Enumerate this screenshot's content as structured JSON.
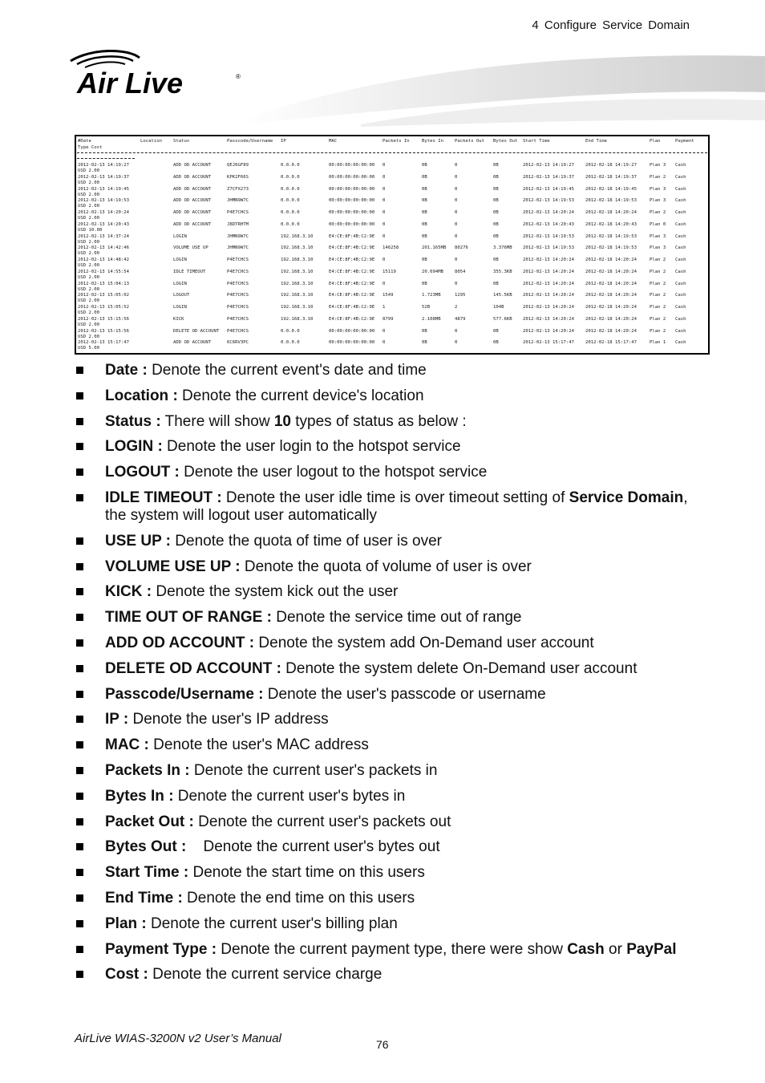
{
  "header": {
    "chapter": "4  Configure  Service  Domain",
    "logo_text": "Air Live"
  },
  "log_table": {
    "headers": [
      "#Date",
      "Location",
      "Status",
      "Passcode/Username",
      "IP",
      "MAC",
      "Packets In",
      "Bytes In",
      "Packets Out",
      "Bytes Out",
      "Start Time",
      "End Time",
      "Plan",
      "Payment"
    ],
    "header_line2": "Type Cost",
    "rows": [
      {
        "date": "2012-02-13 14:19:27",
        "location": "",
        "status": "ADD OD ACCOUNT",
        "user": "QEJ6GF89",
        "ip": "0.0.0.0",
        "mac": "00:00:00:00:00:00",
        "pin": "0",
        "bin": "0B",
        "pout": "0",
        "bout": "0B",
        "start": "2012-02-13 14:19:27",
        "end": "2012-02-18 14:19:27",
        "plan": "Plan 3",
        "payment": "Cash",
        "cost": "USD 2.00"
      },
      {
        "date": "2012-02-13 14:19:37",
        "location": "",
        "status": "ADD OD ACCOUNT",
        "user": "KPK2F66S",
        "ip": "0.0.0.0",
        "mac": "00:00:00:00:00:00",
        "pin": "0",
        "bin": "0B",
        "pout": "0",
        "bout": "0B",
        "start": "2012-02-13 14:19:37",
        "end": "2012-02-18 14:19:37",
        "plan": "Plan 2",
        "payment": "Cash",
        "cost": "USD 2.00"
      },
      {
        "date": "2012-02-13 14:19:45",
        "location": "",
        "status": "ADD OD ACCOUNT",
        "user": "Z7CFX273",
        "ip": "0.0.0.0",
        "mac": "00:00:00:00:00:00",
        "pin": "0",
        "bin": "0B",
        "pout": "0",
        "bout": "0B",
        "start": "2012-02-13 14:19:45",
        "end": "2012-02-18 14:19:45",
        "plan": "Plan 3",
        "payment": "Cash",
        "cost": "USD 2.00"
      },
      {
        "date": "2012-02-13 14:19:53",
        "location": "",
        "status": "ADD OD ACCOUNT",
        "user": "JHMN9W7C",
        "ip": "0.0.0.0",
        "mac": "00:00:00:00:00:00",
        "pin": "0",
        "bin": "0B",
        "pout": "0",
        "bout": "0B",
        "start": "2012-02-13 14:19:53",
        "end": "2012-02-18 14:19:53",
        "plan": "Plan 3",
        "payment": "Cash",
        "cost": "USD 2.00"
      },
      {
        "date": "2012-02-13 14:20:24",
        "location": "",
        "status": "ADD OD ACCOUNT",
        "user": "P4E7CHCS",
        "ip": "0.0.0.0",
        "mac": "00:00:00:00:00:00",
        "pin": "0",
        "bin": "0B",
        "pout": "0",
        "bout": "0B",
        "start": "2012-02-13 14:20:24",
        "end": "2012-02-18 14:20:24",
        "plan": "Plan 2",
        "payment": "Cash",
        "cost": "USD 2.00"
      },
      {
        "date": "2012-02-13 14:20:43",
        "location": "",
        "status": "ADD OD ACCOUNT",
        "user": "J8DTRHTM",
        "ip": "0.0.0.0",
        "mac": "00:00:00:00:00:00",
        "pin": "0",
        "bin": "0B",
        "pout": "0",
        "bout": "0B",
        "start": "2012-02-13 14:20:43",
        "end": "2012-02-18 14:20:43",
        "plan": "Plan 0",
        "payment": "Cash",
        "cost": "USD 10.00"
      },
      {
        "date": "2012-02-13 14:37:24",
        "location": "",
        "status": "LOGIN",
        "user": "JHMN9W7C",
        "ip": "192.168.3.10",
        "mac": "E4:CE:8F:4B:C2:9E",
        "pin": "0",
        "bin": "0B",
        "pout": "0",
        "bout": "0B",
        "start": "2012-02-13 14:19:53",
        "end": "2012-02-18 14:19:53",
        "plan": "Plan 3",
        "payment": "Cash",
        "cost": "USD 2.00"
      },
      {
        "date": "2012-02-13 14:42:46",
        "location": "",
        "status": "VOLUME USE UP",
        "user": "JHMN9W7C",
        "ip": "192.168.3.10",
        "mac": "E4:CE:8F:4B:C2:9E",
        "pin": "146258",
        "bin": "201.165MB",
        "pout": "80276",
        "bout": "3.376MB",
        "start": "2012-02-13 14:19:53",
        "end": "2012-02-18 14:19:53",
        "plan": "Plan 3",
        "payment": "Cash",
        "cost": "USD 2.00"
      },
      {
        "date": "2012-02-13 14:48:42",
        "location": "",
        "status": "LOGIN",
        "user": "P4E7CHCS",
        "ip": "192.168.3.10",
        "mac": "E4:CE:8F:4B:C2:9E",
        "pin": "0",
        "bin": "0B",
        "pout": "0",
        "bout": "0B",
        "start": "2012-02-13 14:20:24",
        "end": "2012-02-18 14:20:24",
        "plan": "Plan 2",
        "payment": "Cash",
        "cost": "USD 2.00"
      },
      {
        "date": "2012-02-13 14:55:54",
        "location": "",
        "status": "IDLE TIMEOUT",
        "user": "P4E7CHCS",
        "ip": "192.168.3.10",
        "mac": "E4:CE:8F:4B:C2:9E",
        "pin": "15119",
        "bin": "20.694MB",
        "pout": "8054",
        "bout": "355.3KB",
        "start": "2012-02-13 14:20:24",
        "end": "2012-02-18 14:20:24",
        "plan": "Plan 2",
        "payment": "Cash",
        "cost": "USD 2.00"
      },
      {
        "date": "2012-02-13 15:04:13",
        "location": "",
        "status": "LOGIN",
        "user": "P4E7CHCS",
        "ip": "192.168.3.10",
        "mac": "E4:CE:8F:4B:C2:9E",
        "pin": "0",
        "bin": "0B",
        "pout": "0",
        "bout": "0B",
        "start": "2012-02-13 14:20:24",
        "end": "2012-02-18 14:20:24",
        "plan": "Plan 2",
        "payment": "Cash",
        "cost": "USD 2.00"
      },
      {
        "date": "2012-02-13 15:05:02",
        "location": "",
        "status": "LOGOUT",
        "user": "P4E7CHCS",
        "ip": "192.168.3.10",
        "mac": "E4:CE:8F:4B:C2:9E",
        "pin": "1549",
        "bin": "1.723MB",
        "pout": "1295",
        "bout": "145.5KB",
        "start": "2012-02-13 14:20:24",
        "end": "2012-02-18 14:20:24",
        "plan": "Plan 2",
        "payment": "Cash",
        "cost": "USD 2.00"
      },
      {
        "date": "2012-02-13 15:05:52",
        "location": "",
        "status": "LOGIN",
        "user": "P4E7CHCS",
        "ip": "192.168.3.10",
        "mac": "E4:CE:8F:4B:C2:9E",
        "pin": "1",
        "bin": "52B",
        "pout": "2",
        "bout": "104B",
        "start": "2012-02-13 14:20:24",
        "end": "2012-02-18 14:20:24",
        "plan": "Plan 2",
        "payment": "Cash",
        "cost": "USD 2.00"
      },
      {
        "date": "2012-02-13 15:15:56",
        "location": "",
        "status": "KICK",
        "user": "P4E7CHCS",
        "ip": "192.168.3.10",
        "mac": "E4:CE:8F:4B:C2:9E",
        "pin": "8799",
        "bin": "2.108MB",
        "pout": "4879",
        "bout": "577.6KB",
        "start": "2012-02-13 14:20:24",
        "end": "2012-02-18 14:20:24",
        "plan": "Plan 2",
        "payment": "Cash",
        "cost": "USD 2.00"
      },
      {
        "date": "2012-02-13 15:15:56",
        "location": "",
        "status": "DELETE OD ACCOUNT",
        "user": "P4E7CHCS",
        "ip": "0.0.0.0",
        "mac": "00:00:00:00:00:00",
        "pin": "0",
        "bin": "0B",
        "pout": "0",
        "bout": "0B",
        "start": "2012-02-13 14:20:24",
        "end": "2012-02-18 14:20:24",
        "plan": "Plan 2",
        "payment": "Cash",
        "cost": "USD 2.00"
      },
      {
        "date": "2012-02-13 15:17:47",
        "location": "",
        "status": "ADD OD ACCOUNT",
        "user": "6C6RV3PC",
        "ip": "0.0.0.0",
        "mac": "00:00:00:00:00:00",
        "pin": "0",
        "bin": "0B",
        "pout": "0",
        "bout": "0B",
        "start": "2012-02-13 15:17:47",
        "end": "2012-02-18 15:17:47",
        "plan": "Plan 1",
        "payment": "Cash",
        "cost": "USD 5.00"
      }
    ]
  },
  "bullets": [
    [
      {
        "b": "Date :"
      },
      {
        "t": " Denote the current event's date and time"
      }
    ],
    [
      {
        "b": "Location :"
      },
      {
        "t": " Denote the current device's location"
      }
    ],
    [
      {
        "b": "Status :"
      },
      {
        "t": " There will show "
      },
      {
        "b": "10"
      },
      {
        "t": " types of status as below :"
      }
    ],
    [
      {
        "b": "LOGIN :"
      },
      {
        "t": " Denote the user login to the hotspot service"
      }
    ],
    [
      {
        "b": "LOGOUT :"
      },
      {
        "t": " Denote the user logout to the hotspot service"
      }
    ],
    [
      {
        "b": "IDLE TIMEOUT :"
      },
      {
        "t": " Denote the user idle time is over timeout setting of "
      },
      {
        "b": "Service Domain"
      },
      {
        "t": ", the system will logout user automatically"
      }
    ],
    [
      {
        "b": "USE UP :"
      },
      {
        "t": " Denote the quota of time of user is over"
      }
    ],
    [
      {
        "b": "VOLUME USE UP :"
      },
      {
        "t": " Denote the quota of volume of user is over"
      }
    ],
    [
      {
        "b": "KICK :"
      },
      {
        "t": " Denote the system kick out the user"
      }
    ],
    [
      {
        "b": "TIME OUT OF RANGE :"
      },
      {
        "t": " Denote the service time out of range"
      }
    ],
    [
      {
        "b": "ADD OD ACCOUNT :"
      },
      {
        "t": " Denote the system add On-Demand user account"
      }
    ],
    [
      {
        "b": "DELETE OD ACCOUNT :"
      },
      {
        "t": " Denote the system delete On-Demand user account"
      }
    ],
    [
      {
        "b": "Passcode/Username :"
      },
      {
        "t": " Denote the user's passcode or username"
      }
    ],
    [
      {
        "b": "IP :"
      },
      {
        "t": " Denote the user's IP address"
      }
    ],
    [
      {
        "b": "MAC :"
      },
      {
        "t": " Denote the user's MAC address"
      }
    ],
    [
      {
        "b": "Packets In :"
      },
      {
        "t": " Denote the current user's packets in"
      }
    ],
    [
      {
        "b": "Bytes In :"
      },
      {
        "t": " Denote the current user's bytes in"
      }
    ],
    [
      {
        "b": "Packet Out :"
      },
      {
        "t": " Denote the current user's packets out"
      }
    ],
    [
      {
        "b": "Bytes Out :"
      },
      {
        "t": "    Denote the current user's bytes out"
      }
    ],
    [
      {
        "b": "Start Time :"
      },
      {
        "t": " Denote the start time on this users"
      }
    ],
    [
      {
        "b": "End Time :"
      },
      {
        "t": " Denote the end time on this users"
      }
    ],
    [
      {
        "b": "Plan :"
      },
      {
        "t": " Denote the current user's billing plan"
      }
    ],
    [
      {
        "b": "Payment Type :"
      },
      {
        "t": " Denote the current payment type, there were show "
      },
      {
        "b": "Cash"
      },
      {
        "t": " or "
      },
      {
        "b": "PayPal"
      }
    ],
    [
      {
        "b": "Cost :"
      },
      {
        "t": " Denote the current service charge"
      }
    ]
  ],
  "footer": {
    "manual": "AirLive WIAS-3200N v2 User’s Manual",
    "page": "76"
  }
}
